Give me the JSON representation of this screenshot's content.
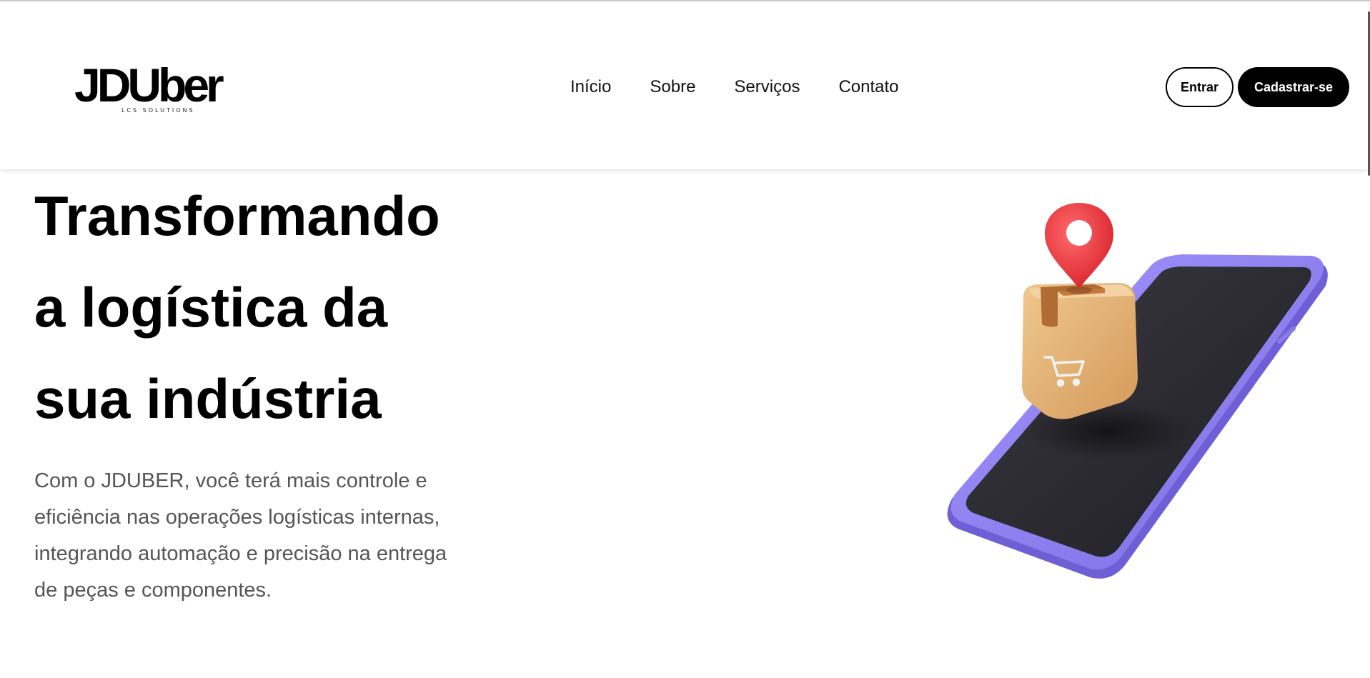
{
  "brand": {
    "logo_text": "JDUber",
    "logo_subtext": "LCS SOLUTIONS"
  },
  "nav": {
    "items": [
      {
        "label": "Início"
      },
      {
        "label": "Sobre"
      },
      {
        "label": "Serviços"
      },
      {
        "label": "Contato"
      }
    ]
  },
  "auth": {
    "login_label": "Entrar",
    "signup_label": "Cadastrar-se"
  },
  "hero": {
    "title_lines": [
      "Transformando",
      "a logística da",
      "sua indústria"
    ],
    "description": "Com o JDUBER, você terá mais controle e eficiência nas operações logísticas internas, integrando automação e precisão na entrega de peças e componentes."
  },
  "illustration": {
    "icons": [
      "phone-icon",
      "location-pin-icon",
      "package-box-icon",
      "shopping-cart-icon"
    ],
    "colors": {
      "phone_frame": "#8f7ff0",
      "phone_screen": "#2b2a30",
      "pin": "#e8383d",
      "box": "#e2ac6c",
      "tape": "#a8652e"
    }
  }
}
